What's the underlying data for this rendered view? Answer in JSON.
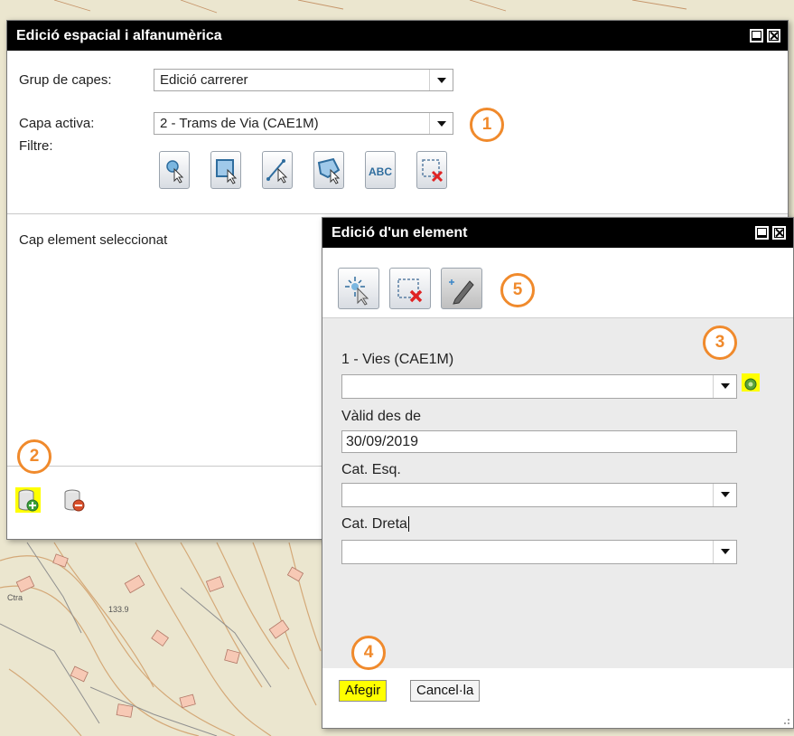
{
  "main_window": {
    "title": "Edició espacial i alfanumèrica",
    "group_label": "Grup de capes:",
    "group_value": "Edició carrerer",
    "layer_label": "Capa activa:",
    "layer_value": "2 - Trams de Via (CAE1M)",
    "filter_label": "Filtre:",
    "filter_tools": [
      "select-point-icon",
      "select-rectangle-icon",
      "select-line-icon",
      "select-polygon-icon",
      "text-filter-icon",
      "clear-selection-icon"
    ],
    "filter_text_icon_label": "ABC",
    "selection_status": "Cap element seleccionat"
  },
  "element_window": {
    "title": "Edició d'un element",
    "tools": [
      "select-element-icon",
      "delete-selection-icon",
      "edit-draw-icon"
    ],
    "fields": {
      "vies_label": "1 - Vies (CAE1M)",
      "vies_value": "",
      "valid_from_label": "Vàlid des de",
      "valid_from_value": "30/09/2019",
      "cat_esq_label": "Cat. Esq.",
      "cat_esq_value": "",
      "cat_dreta_label": "Cat. Dreta",
      "cat_dreta_value": ""
    },
    "add_button": "Afegir",
    "cancel_button": "Cancel·la"
  },
  "callouts": [
    "1",
    "2",
    "3",
    "4",
    "5"
  ],
  "colors": {
    "titlebar": "#000000",
    "highlight": "#ffff00",
    "callout": "#f08a2c"
  },
  "map_labels": [
    "133.9",
    "Ctra"
  ]
}
